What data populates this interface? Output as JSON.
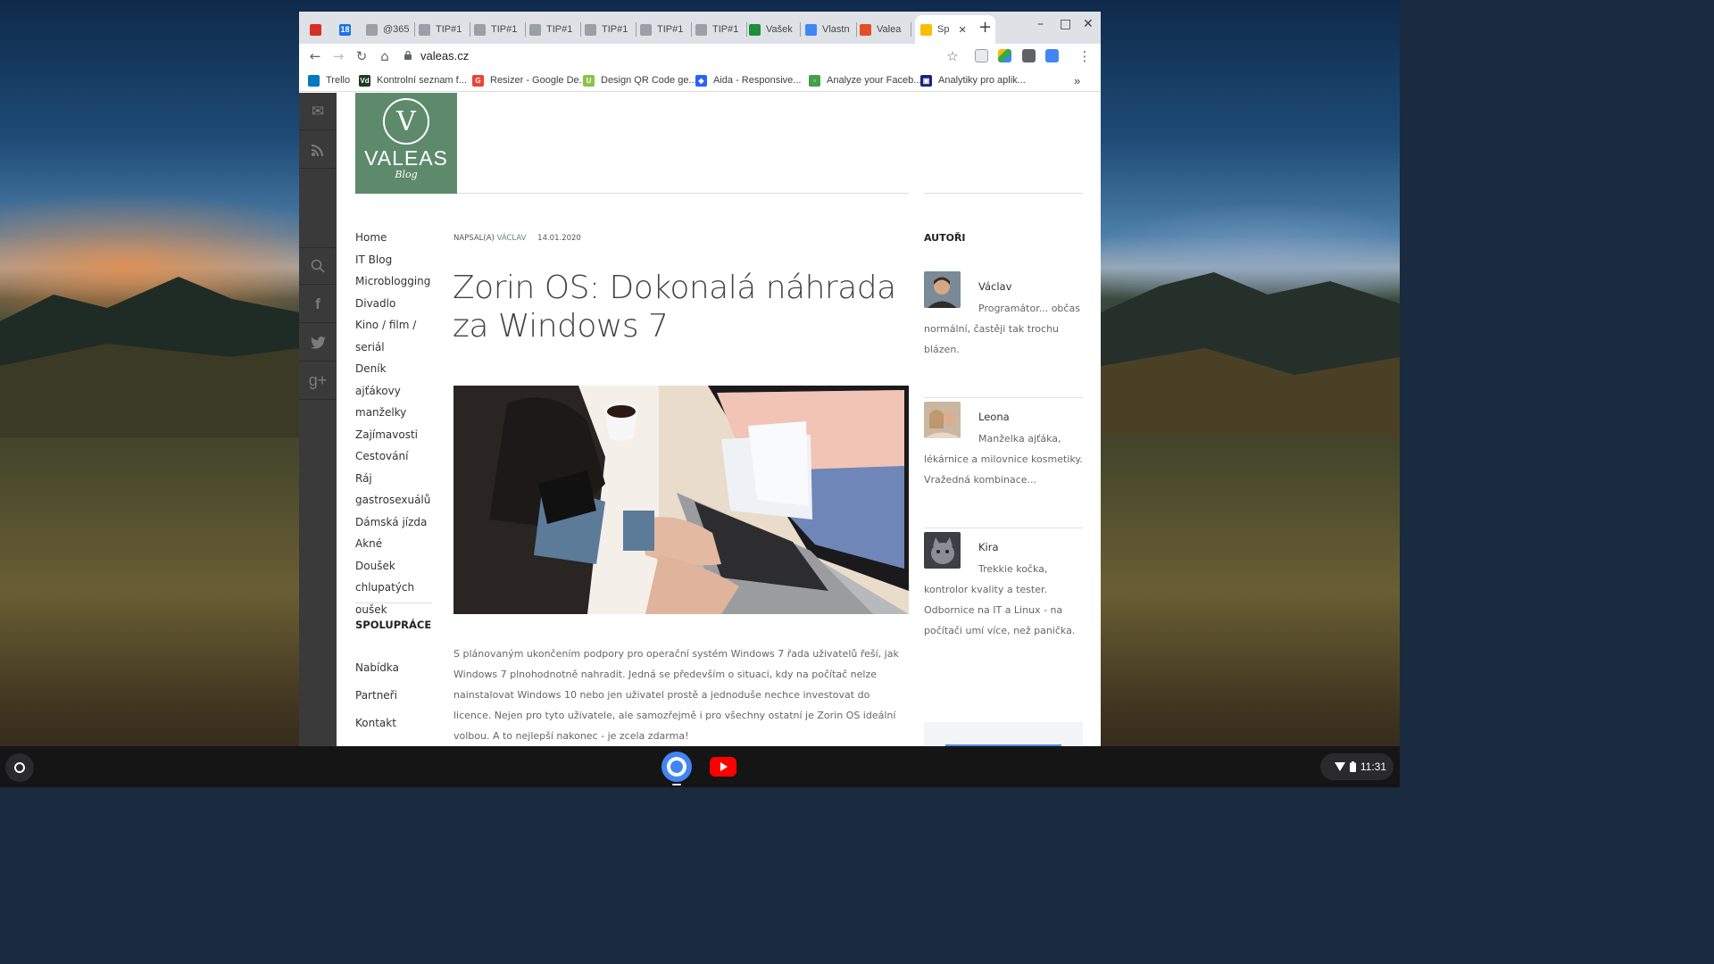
{
  "tabs": [
    {
      "label": "",
      "icon": "gmail-icon",
      "color": "#d93025"
    },
    {
      "label": "",
      "icon": "calendar-icon",
      "color": "#1a73e8",
      "badge": "18"
    },
    {
      "label": "@365",
      "icon": "pin-icon",
      "color": "#9aa0a6"
    },
    {
      "label": "TIP#1",
      "icon": "pin-icon",
      "color": "#9aa0a6"
    },
    {
      "label": "TIP#1",
      "icon": "pin-icon",
      "color": "#9aa0a6"
    },
    {
      "label": "TIP#1",
      "icon": "pin-icon",
      "color": "#9aa0a6"
    },
    {
      "label": "TIP#1",
      "icon": "pin-icon",
      "color": "#9aa0a6"
    },
    {
      "label": "TIP#1",
      "icon": "pin-icon",
      "color": "#9aa0a6"
    },
    {
      "label": "TIP#1",
      "icon": "pin-icon",
      "color": "#9aa0a6"
    },
    {
      "label": "Vašek",
      "icon": "drive-icon",
      "color": "#1e8e3e"
    },
    {
      "label": "Vlastn",
      "icon": "docs-icon",
      "color": "#4285f4"
    },
    {
      "label": "Valea",
      "icon": "joomla-icon",
      "color": "#e44d26"
    },
    {
      "label": "Sp",
      "icon": "chrome-apps-icon",
      "color": "#fbbc04",
      "active": true
    }
  ],
  "new_tab_label": "+",
  "window_controls": {
    "minimize": "–",
    "maximize": "□",
    "close": "✕"
  },
  "address": {
    "url": "valeas.cz"
  },
  "bookmarks": [
    {
      "label": "Trello",
      "icon": "trello-icon",
      "color": "#0079bf",
      "letter": ""
    },
    {
      "label": "Kontrolní seznam f...",
      "icon": "vd-icon",
      "color": "#1c3b1f",
      "letter": "Vd"
    },
    {
      "label": "Resizer - Google De...",
      "icon": "google-icon",
      "color": "#ea4335",
      "letter": "G"
    },
    {
      "label": "Design QR Code ge...",
      "icon": "qr-icon",
      "color": "#8bc34a",
      "letter": "U"
    },
    {
      "label": "Aida - Responsive...",
      "icon": "aida-icon",
      "color": "#2962ff",
      "letter": "◆"
    },
    {
      "label": "Analyze your Faceb...",
      "icon": "analyze-icon",
      "color": "#43a047",
      "letter": "▫"
    },
    {
      "label": "Analytiky pro aplik...",
      "icon": "analytics-icon",
      "color": "#1a237e",
      "letter": "▣"
    }
  ],
  "bookmarks_more": "»",
  "site": {
    "logo_text": "VALEAS",
    "logo_sub": "Blog",
    "logo_letter": "V",
    "menu": [
      "Home",
      "IT Blog",
      "Microblogging",
      "Divadlo",
      "Kino / film /",
      "seriál",
      "Deník ajťákovy",
      "manželky",
      "Zajímavosti",
      "Cestování",
      "Ráj",
      "gastrosexuálů",
      "Dámská jízda",
      "Akné",
      "Doušek",
      "chlupatých",
      "oušek"
    ],
    "menu_heading": "SPOLUPRÁCE",
    "menu_links": [
      "Nabídka",
      "Partneři",
      "Kontakt"
    ]
  },
  "article": {
    "meta_prefix": "NAPSAL(A)",
    "author": "VÁCLAV",
    "date": "14.01.2020",
    "title": "Zorin OS: Dokonalá náhrada za Windows 7",
    "body": "S plánovaným ukončením podpory pro operační systém Windows 7 řada uživatelů řeší, jak Windows 7 plnohodnotně nahradit. Jedná se především o situaci, kdy na počítač nelze nainstalovat Windows 10 nebo jen uživatel prostě a jednoduše nechce investovat do licence. Nejen pro tyto uživatele, ale samozřejmě i pro všechny ostatní je Zorin OS ideální volbou. A to nejlepší nakonec - je zcela zdarma!"
  },
  "sidebar": {
    "title": "AUTOŘI",
    "authors": [
      {
        "name": "Václav",
        "desc": "Programátor... občas normální, častěji tak trochu blázen."
      },
      {
        "name": "Leona",
        "desc": "Manželka ajťáka, lékárnice a milovnice kosmetiky. Vražedná kombinace..."
      },
      {
        "name": "Kira",
        "desc": "Trekkie kočka, kontrolor kvality a tester. Odbornice na IT a Linux - na počítači umí více, než panička."
      }
    ]
  },
  "shelf": {
    "time": "11:31"
  }
}
